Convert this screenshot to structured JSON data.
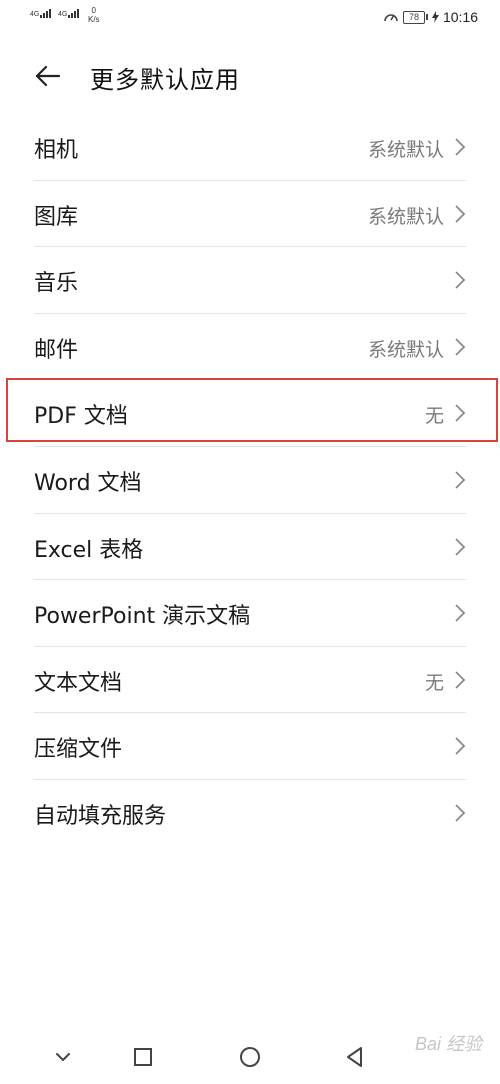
{
  "status_bar": {
    "signal_1": "4G",
    "signal_2": "4G",
    "speed_value": "0",
    "speed_unit": "K/s",
    "battery_level": "78",
    "time": "10:16"
  },
  "header": {
    "title": "更多默认应用"
  },
  "items": [
    {
      "label": "相机",
      "value": "系统默认"
    },
    {
      "label": "图库",
      "value": "系统默认"
    },
    {
      "label": "音乐",
      "value": ""
    },
    {
      "label": "邮件",
      "value": "系统默认"
    },
    {
      "label": "PDF 文档",
      "value": "无"
    },
    {
      "label": "Word 文档",
      "value": ""
    },
    {
      "label": "Excel 表格",
      "value": ""
    },
    {
      "label": "PowerPoint 演示文稿",
      "value": ""
    },
    {
      "label": "文本文档",
      "value": "无"
    },
    {
      "label": "压缩文件",
      "value": ""
    },
    {
      "label": "自动填充服务",
      "value": ""
    }
  ],
  "watermark": "Bai 经验",
  "colors": {
    "highlight": "#d9433d",
    "value_text": "#7a7a7a",
    "divider": "#e4e4e4"
  }
}
